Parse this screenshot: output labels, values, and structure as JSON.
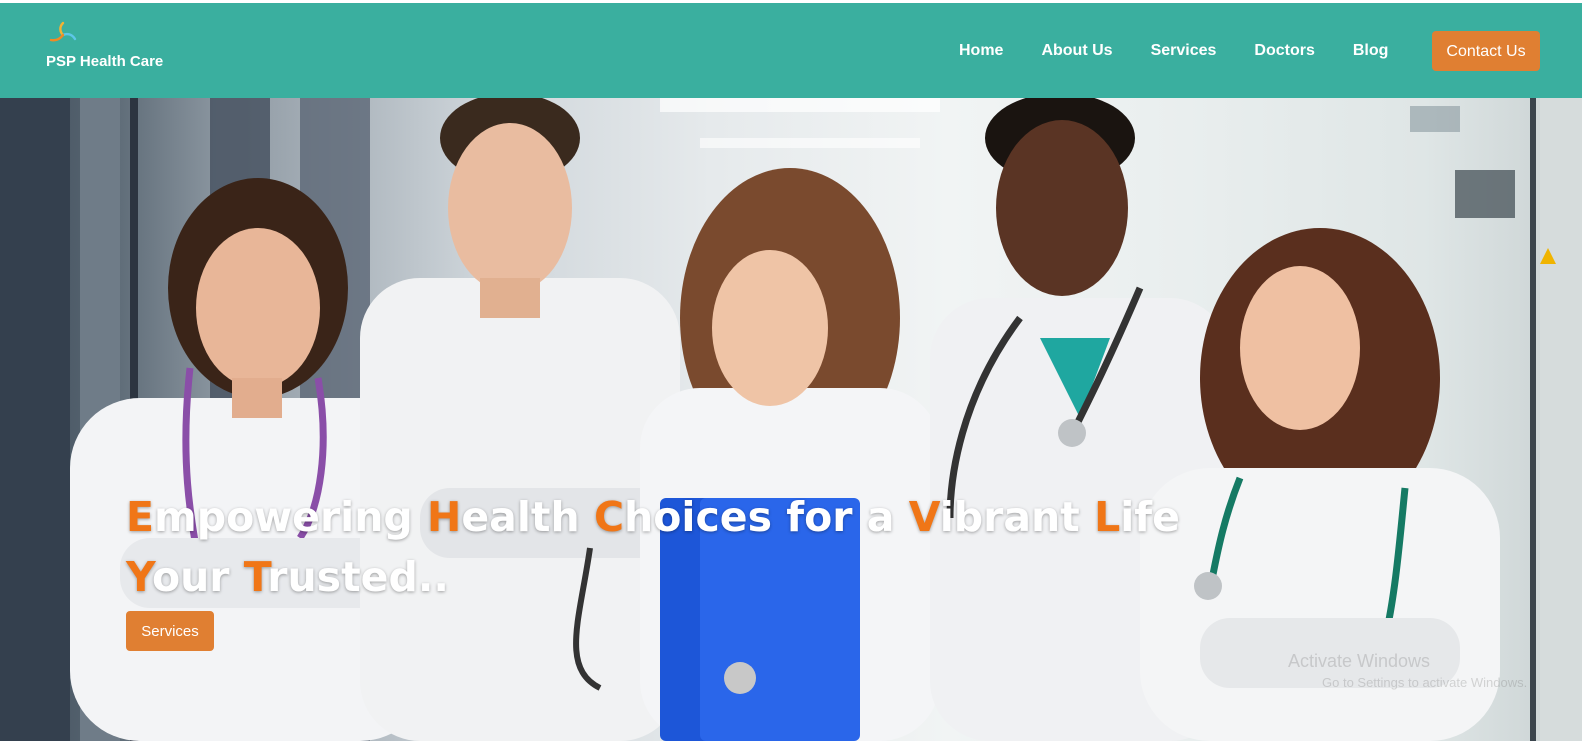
{
  "brand": {
    "name": "PSP Health Care",
    "logo_icon": "flower-swirl-logo-icon"
  },
  "nav": {
    "items": [
      {
        "label": "Home"
      },
      {
        "label": "About Us"
      },
      {
        "label": "Services"
      },
      {
        "label": "Doctors"
      },
      {
        "label": "Blog"
      }
    ],
    "contact_label": "Contact Us"
  },
  "hero": {
    "line1": [
      {
        "cap": "E",
        "rest": "mpowering "
      },
      {
        "cap": "H",
        "rest": "ealth "
      },
      {
        "cap": "C",
        "rest": "hoices for a "
      },
      {
        "cap": "V",
        "rest": "ibrant "
      },
      {
        "cap": "L",
        "rest": "ife"
      }
    ],
    "line2": [
      {
        "cap": "Y",
        "rest": "our "
      },
      {
        "cap": "T",
        "rest": "rusted.."
      }
    ],
    "button_label": "Services",
    "image_subject": "team of five smiling doctors in white coats with stethoscopes in a hospital corridor"
  },
  "watermark": {
    "line1": "Activate Windows",
    "line2": "Go to Settings to activate Windows."
  },
  "colors": {
    "navbar": "#3aaf9f",
    "accent_button": "#e07f32",
    "highlight_letter": "#f07617",
    "text_white": "#ffffff"
  }
}
